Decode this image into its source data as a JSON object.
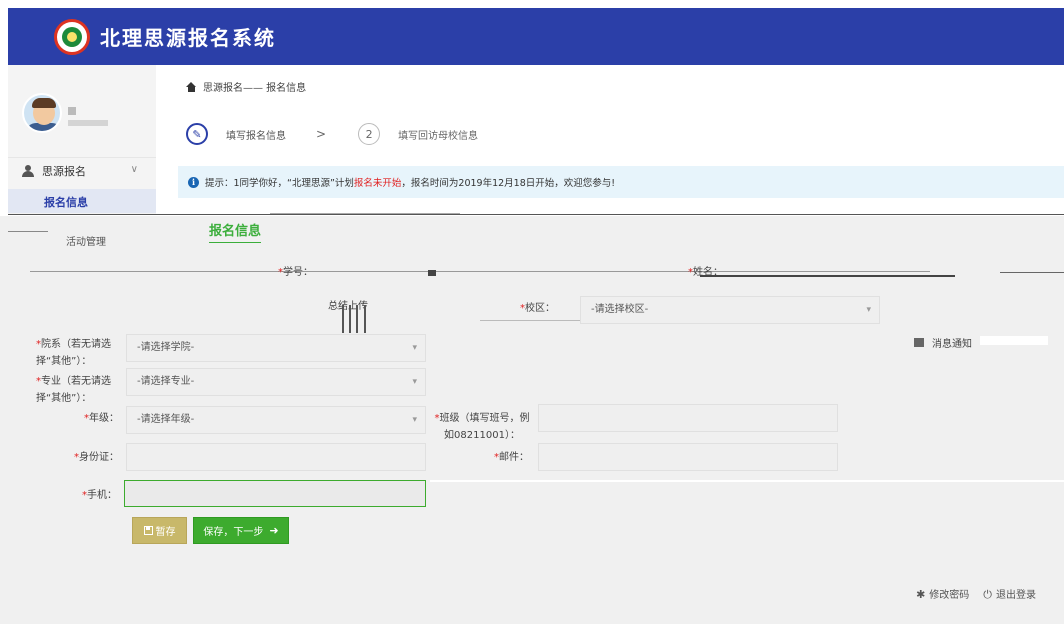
{
  "header": {
    "title": "北理思源报名系统"
  },
  "sidebar": {
    "section_label": "思源报名",
    "active_item": "报名信息",
    "activity_item": "活动管理"
  },
  "breadcrumb": {
    "text": "思源报名—— 报名信息"
  },
  "steps": [
    {
      "number": "",
      "label": "填写报名信息"
    },
    {
      "number": "2",
      "label": "填写回访母校信息"
    }
  ],
  "step_separator": ">",
  "notice": {
    "prefix": "提示：1同学你好，“北理思源”计划",
    "status": "报名未开始",
    "suffix": "，报名时间为2019年12月18日开始，欢迎您参与!"
  },
  "form": {
    "title": "报名信息",
    "student_id_label": "学号：",
    "name_label": "姓名：",
    "summary_label": "总结上传",
    "campus_label": "校区：",
    "campus_value": "-请选择校区-",
    "college_label": "院系（若无请选择“其他”）：",
    "college_value": "-请选择学院-",
    "major_label": "专业（若无请选择“其他”）：",
    "major_value": "-请选择专业-",
    "grade_label": "年级：",
    "grade_value": "-请选择年级-",
    "class_label": "班级（填写班号，例如08211001）：",
    "class_value": "",
    "id_card_label": "身份证：",
    "id_card_value": "",
    "email_label": "邮件：",
    "email_value": "",
    "phone_label": "手机：",
    "phone_value": ""
  },
  "buttons": {
    "save": "暂存",
    "next": "保存，下一步"
  },
  "message": {
    "label": "消息通知"
  },
  "footer": {
    "change_password": "修改密码",
    "logout": "退出登录"
  },
  "colors": {
    "header_bg": "#2b3fa8",
    "accent_green": "#3dab2e",
    "notice_red": "#e02020",
    "save_btn": "#c8b86a"
  }
}
